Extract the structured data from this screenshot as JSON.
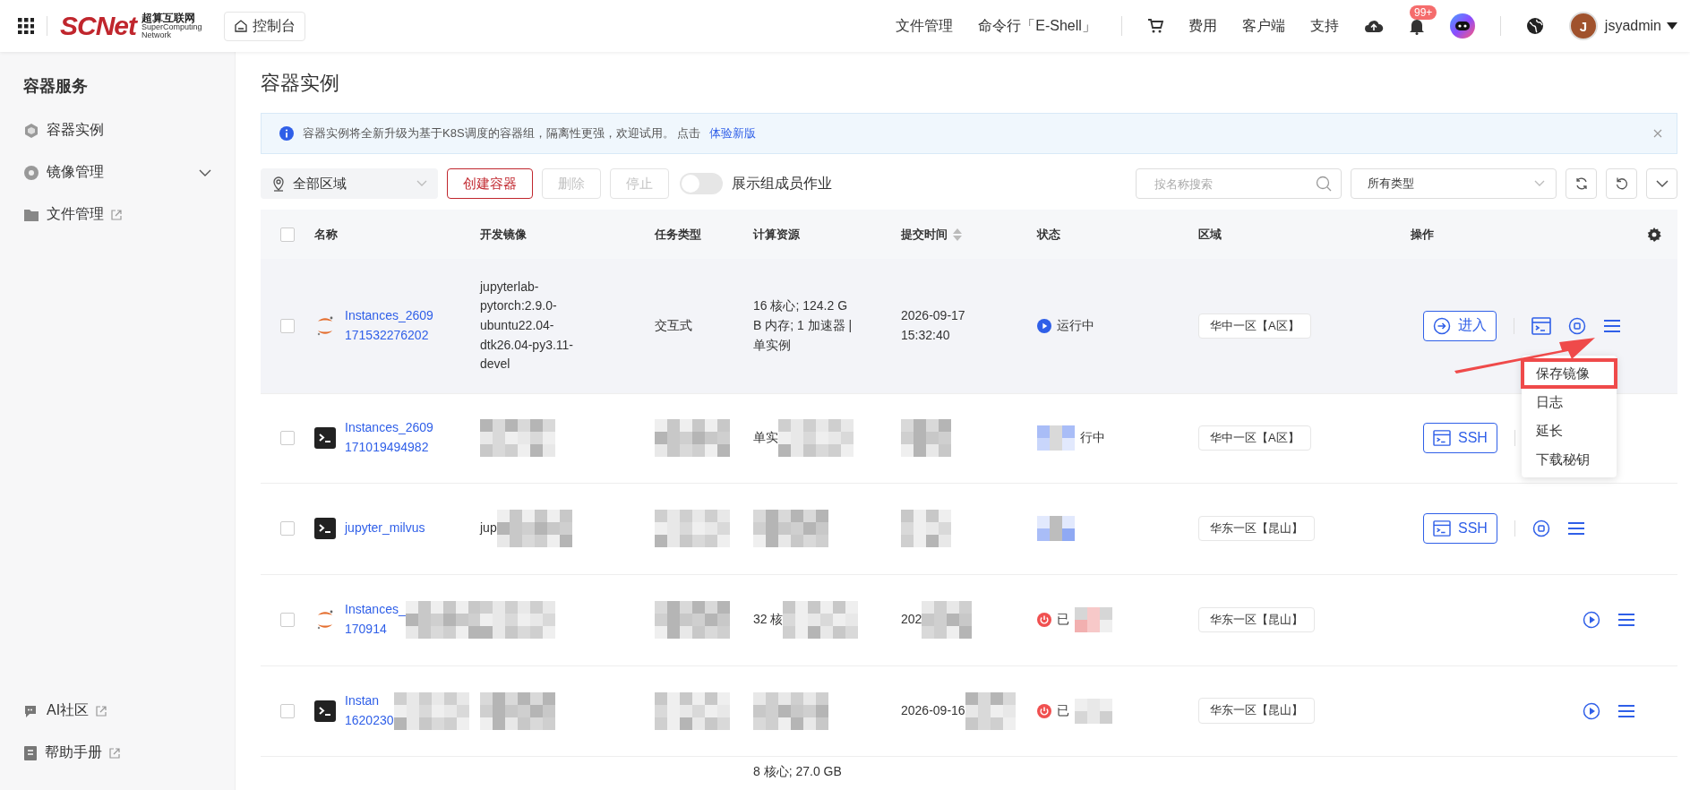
{
  "topbar": {
    "logo": {
      "mark": "SCNet",
      "cn": "超算互联网",
      "en1": "SuperComputing",
      "en2": "Network"
    },
    "console": "控制台",
    "nav": [
      "文件管理",
      "命令行「E-Shell」"
    ],
    "links": [
      "费用",
      "客户端",
      "支持"
    ],
    "badge": "99+",
    "user_initial": "J",
    "username": "jsyadmin"
  },
  "sidebar": {
    "title": "容器服务",
    "items": [
      {
        "label": "容器实例",
        "kind": "plain"
      },
      {
        "label": "镜像管理",
        "kind": "expandable"
      },
      {
        "label": "文件管理",
        "kind": "external"
      }
    ],
    "bottom_items": [
      {
        "label": "AI社区",
        "kind": "external"
      },
      {
        "label": "帮助手册",
        "kind": "external"
      }
    ]
  },
  "page_title": "容器实例",
  "notice": {
    "text": "容器实例将全新升级为基于K8S调度的容器组，隔离性更强，欢迎试用。 点击",
    "link": "体验新版"
  },
  "toolbar": {
    "region": "全部区域",
    "buttons": [
      {
        "label": "创建容器",
        "disabled": false
      },
      {
        "label": "删除",
        "disabled": true
      },
      {
        "label": "停止",
        "disabled": true
      }
    ],
    "toggle": {
      "label": "展示组成员作业",
      "on": false
    },
    "search": {
      "placeholder": "按名称搜索"
    },
    "type_select": "所有类型"
  },
  "table": {
    "select_all": {
      "checked": false
    },
    "columns": [
      "名称",
      "开发镜像",
      "任务类型",
      "计算资源",
      "提交时间",
      "状态",
      "区域",
      "操作"
    ],
    "rows": [
      {
        "selected": true,
        "checked": false,
        "kind": "jupyter",
        "name": {
          "lines": [
            "Instances_2609",
            "171532276202"
          ]
        },
        "image": {
          "lines": [
            "jupyterlab-",
            "pytorch:2.9.0-",
            "ubuntu22.04-",
            "dtk26.04-py3.11-",
            "devel"
          ]
        },
        "task": {
          "lines": [
            "交互式"
          ]
        },
        "compute": {
          "lines": [
            "16 核心; 124.2 G",
            "B 内存; 1 加速器 |",
            "单实例"
          ]
        },
        "time": {
          "lines": [
            "2026-09-17",
            "15:32:40"
          ]
        },
        "status": {
          "kind": "running",
          "text": "运行中"
        },
        "region": "华中一区【A区】",
        "primary": {
          "kind": "enter",
          "label": "进入"
        },
        "extras": [
          {
            "kind": "terminal"
          },
          {
            "kind": "stop"
          },
          {
            "kind": "menu"
          }
        ]
      },
      {
        "selected": false,
        "checked": false,
        "kind": "terminal",
        "name": {
          "lines": [
            "Instances_2609",
            "171019494982"
          ]
        },
        "image": {
          "redacted": true
        },
        "task": {
          "redacted": true
        },
        "compute": {
          "lines": [
            "单实"
          ],
          "redacted": true
        },
        "time": {
          "redacted": true
        },
        "status": {
          "kind": "running",
          "text": "行中",
          "redacted": true
        },
        "region": "华中一区【A区】",
        "primary": {
          "kind": "ssh",
          "label": "SSH"
        }
      },
      {
        "selected": false,
        "checked": false,
        "kind": "terminal",
        "name": {
          "lines": [
            "jupyter_milvus"
          ]
        },
        "image": {
          "lines": [
            "jup"
          ],
          "redacted": true
        },
        "task": {
          "redacted": true
        },
        "compute": {
          "redacted": true
        },
        "time": {
          "redacted": true
        },
        "status": {
          "kind": "running",
          "redacted": true
        },
        "region": "华东一区【昆山】",
        "primary": {
          "kind": "ssh",
          "label": "SSH"
        },
        "extras": [
          {
            "kind": "stop"
          },
          {
            "kind": "menu"
          }
        ]
      },
      {
        "selected": false,
        "checked": false,
        "kind": "jupyter",
        "name": {
          "lines": [
            "Instances_",
            "170914"
          ],
          "redacted": true
        },
        "image": {
          "redacted": true
        },
        "task": {
          "redacted": true
        },
        "compute": {
          "lines": [
            "32 核"
          ],
          "redacted": true
        },
        "time": {
          "lines": [
            "202"
          ],
          "redacted": true
        },
        "status": {
          "kind": "stopped",
          "text": "已",
          "redacted": true
        },
        "region": "华东一区【昆山】",
        "extras": [
          {
            "kind": "play"
          },
          {
            "kind": "menu"
          }
        ]
      },
      {
        "selected": false,
        "checked": false,
        "kind": "terminal",
        "name": {
          "lines": [
            "Instan",
            "1620230"
          ],
          "redacted": true
        },
        "image": {
          "redacted": true
        },
        "task": {
          "redacted": true
        },
        "compute": {
          "redacted": true
        },
        "time": {
          "lines": [
            "2026-09-16"
          ],
          "redacted": true
        },
        "status": {
          "kind": "stopped",
          "text": "已",
          "redacted": true
        },
        "region": "华东一区【昆山】",
        "extras": [
          {
            "kind": "play"
          },
          {
            "kind": "menu"
          }
        ]
      },
      {
        "selected": false,
        "kind": "partial",
        "compute": {
          "lines": [
            "8 核心; 27.0 GB"
          ]
        }
      }
    ]
  },
  "menu": {
    "items": [
      {
        "label": "保存镜像",
        "highlighted": true
      },
      {
        "label": "日志",
        "highlighted": false
      },
      {
        "label": "延长",
        "highlighted": false
      },
      {
        "label": "下载秘钥",
        "highlighted": false
      }
    ]
  }
}
